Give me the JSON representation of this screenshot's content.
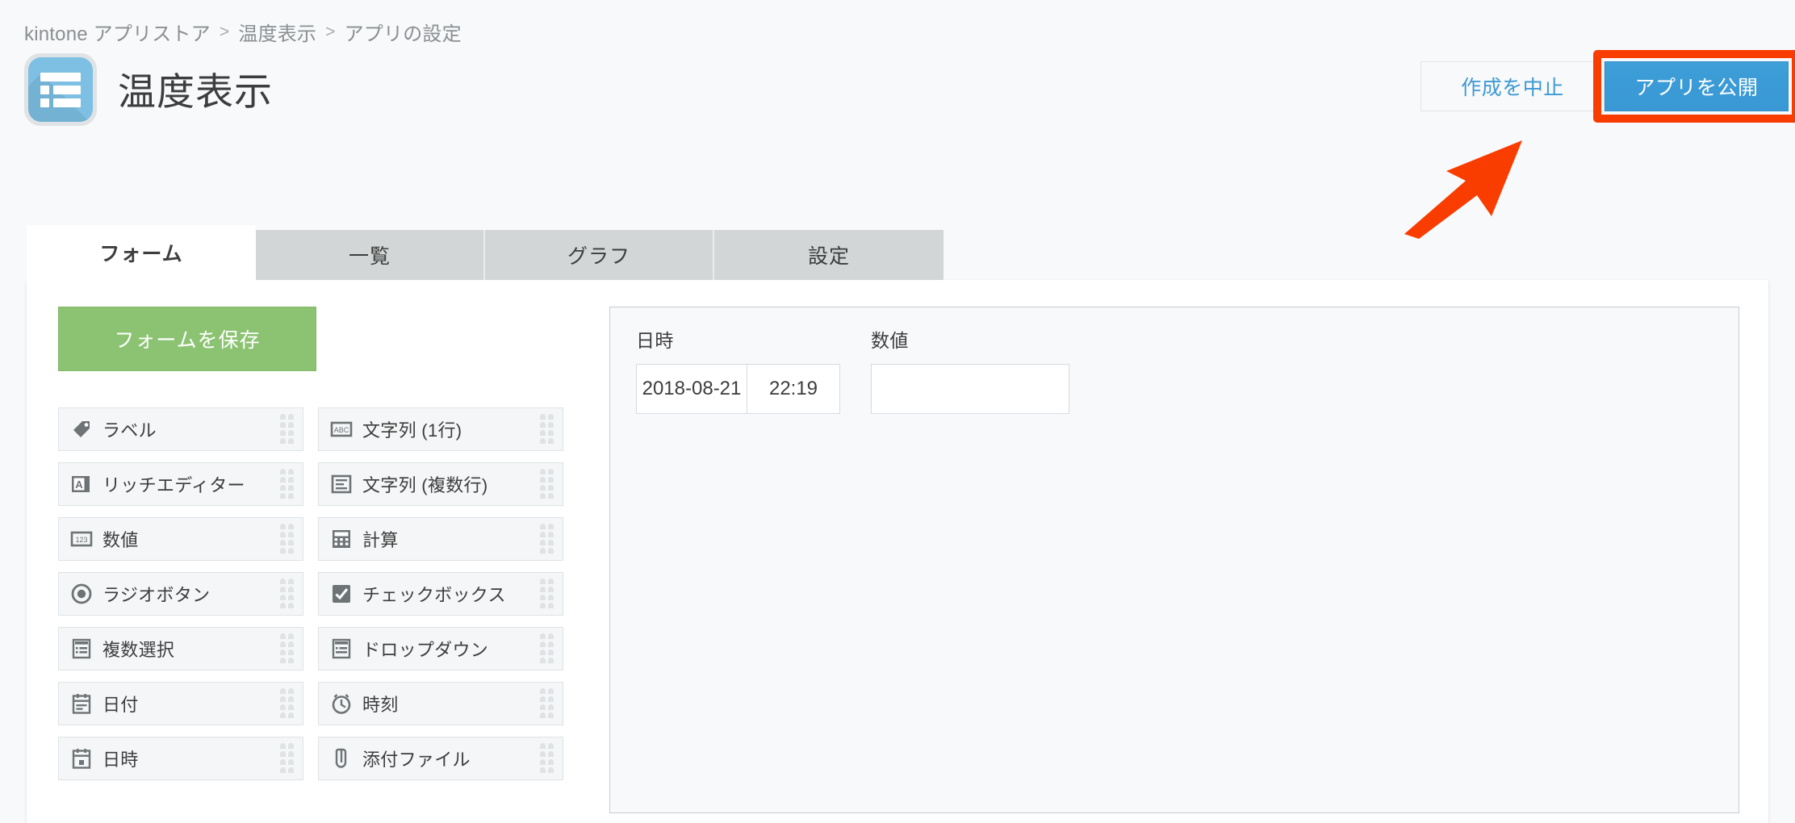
{
  "breadcrumb": {
    "items": [
      "kintone アプリストア",
      "温度表示",
      "アプリの設定"
    ],
    "separator": ">"
  },
  "header": {
    "app_title": "温度表示",
    "app_icon": "list-app-icon",
    "cancel_label": "作成を中止",
    "publish_label": "アプリを公開",
    "highlight_color": "#f93c00",
    "publish_color": "#3b9bd6",
    "cancel_text_color": "#3e9ad4"
  },
  "annotation": {
    "arrow_color": "#f93c00",
    "arrow_target": "publish-button"
  },
  "tabs": [
    {
      "label": "フォーム",
      "active": true
    },
    {
      "label": "一覧",
      "active": false
    },
    {
      "label": "グラフ",
      "active": false
    },
    {
      "label": "設定",
      "active": false
    }
  ],
  "palette": {
    "save_label": "フォームを保存",
    "save_color": "#8cc373",
    "fields": [
      {
        "label": "ラベル",
        "icon": "tag-icon"
      },
      {
        "label": "文字列 (1行)",
        "icon": "abc-icon"
      },
      {
        "label": "リッチエディター",
        "icon": "rich-text-a-icon"
      },
      {
        "label": "文字列 (複数行)",
        "icon": "multiline-text-icon"
      },
      {
        "label": "数値",
        "icon": "123-number-icon"
      },
      {
        "label": "計算",
        "icon": "calculator-icon"
      },
      {
        "label": "ラジオボタン",
        "icon": "radio-button-icon"
      },
      {
        "label": "チェックボックス",
        "icon": "checkbox-icon"
      },
      {
        "label": "複数選択",
        "icon": "multi-select-icon"
      },
      {
        "label": "ドロップダウン",
        "icon": "dropdown-icon"
      },
      {
        "label": "日付",
        "icon": "calendar-date-icon"
      },
      {
        "label": "時刻",
        "icon": "clock-icon"
      },
      {
        "label": "日時",
        "icon": "calendar-datetime-icon"
      },
      {
        "label": "添付ファイル",
        "icon": "paperclip-icon"
      }
    ]
  },
  "form_preview": {
    "datetime_field": {
      "label": "日時",
      "date_value": "2018-08-21",
      "time_value": "22:19"
    },
    "number_field": {
      "label": "数値",
      "value": ""
    }
  }
}
